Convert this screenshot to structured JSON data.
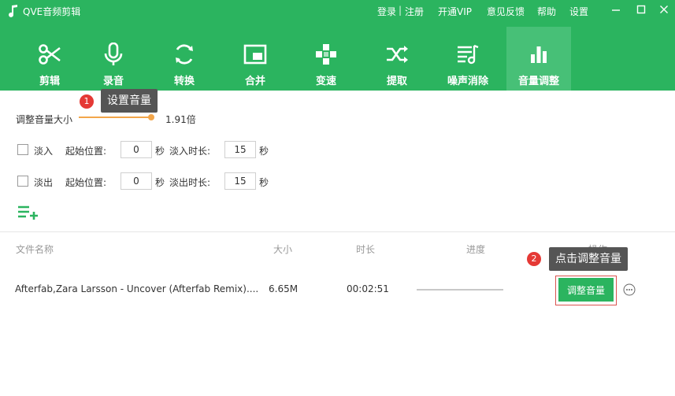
{
  "app": {
    "title": "QVE音频剪辑",
    "logo_icon": "music-note-icon"
  },
  "topbar": {
    "login": "登录",
    "separator": "|",
    "register": "注册",
    "vip": "开通VIP",
    "feedback": "意见反馈",
    "help": "帮助",
    "settings": "设置",
    "window_controls": [
      "minimize-icon",
      "maximize-icon",
      "close-icon"
    ]
  },
  "tabs": [
    {
      "label": "剪辑",
      "icon": "scissors-icon",
      "active": false
    },
    {
      "label": "录音",
      "icon": "microphone-icon",
      "active": false
    },
    {
      "label": "转换",
      "icon": "convert-icon",
      "active": false
    },
    {
      "label": "合并",
      "icon": "merge-icon",
      "active": false
    },
    {
      "label": "变速",
      "icon": "speed-icon",
      "active": false
    },
    {
      "label": "提取",
      "icon": "extract-icon",
      "active": false
    },
    {
      "label": "噪声消除",
      "icon": "noise-reduction-icon",
      "active": false
    },
    {
      "label": "音量调整",
      "icon": "volume-bars-icon",
      "active": true
    }
  ],
  "tooltips": {
    "step1": {
      "badge": "1",
      "text": "设置音量"
    },
    "step2": {
      "badge": "2",
      "text": "点击调整音量"
    }
  },
  "volume": {
    "label": "调整音量大小",
    "value": "1.91倍",
    "slider_fraction": 0.96
  },
  "fade_in": {
    "label": "淡入",
    "start_label": "起始位置:",
    "start_value": "0",
    "unit": "秒",
    "duration_label": "淡入时长:",
    "duration_value": "15",
    "duration_unit": "秒"
  },
  "fade_out": {
    "label": "淡出",
    "start_label": "起始位置:",
    "start_value": "0",
    "unit": "秒",
    "duration_label": "淡出时长:",
    "duration_value": "15",
    "duration_unit": "秒"
  },
  "table": {
    "headers": {
      "name": "文件名称",
      "size": "大小",
      "duration": "时长",
      "progress": "进度",
      "action": "操作"
    },
    "rows": [
      {
        "name": "Afterfab,Zara Larsson - Uncover (Afterfab Remix)....",
        "size": "6.65M",
        "duration": "00:02:51",
        "progress": 0,
        "action": "调整音量"
      }
    ]
  },
  "colors": {
    "brand_green": "#2bb45f",
    "active_tab": "#47c077",
    "slider": "#f3a64a",
    "badge_red": "#e53935",
    "tooltip_bg": "#555555"
  }
}
